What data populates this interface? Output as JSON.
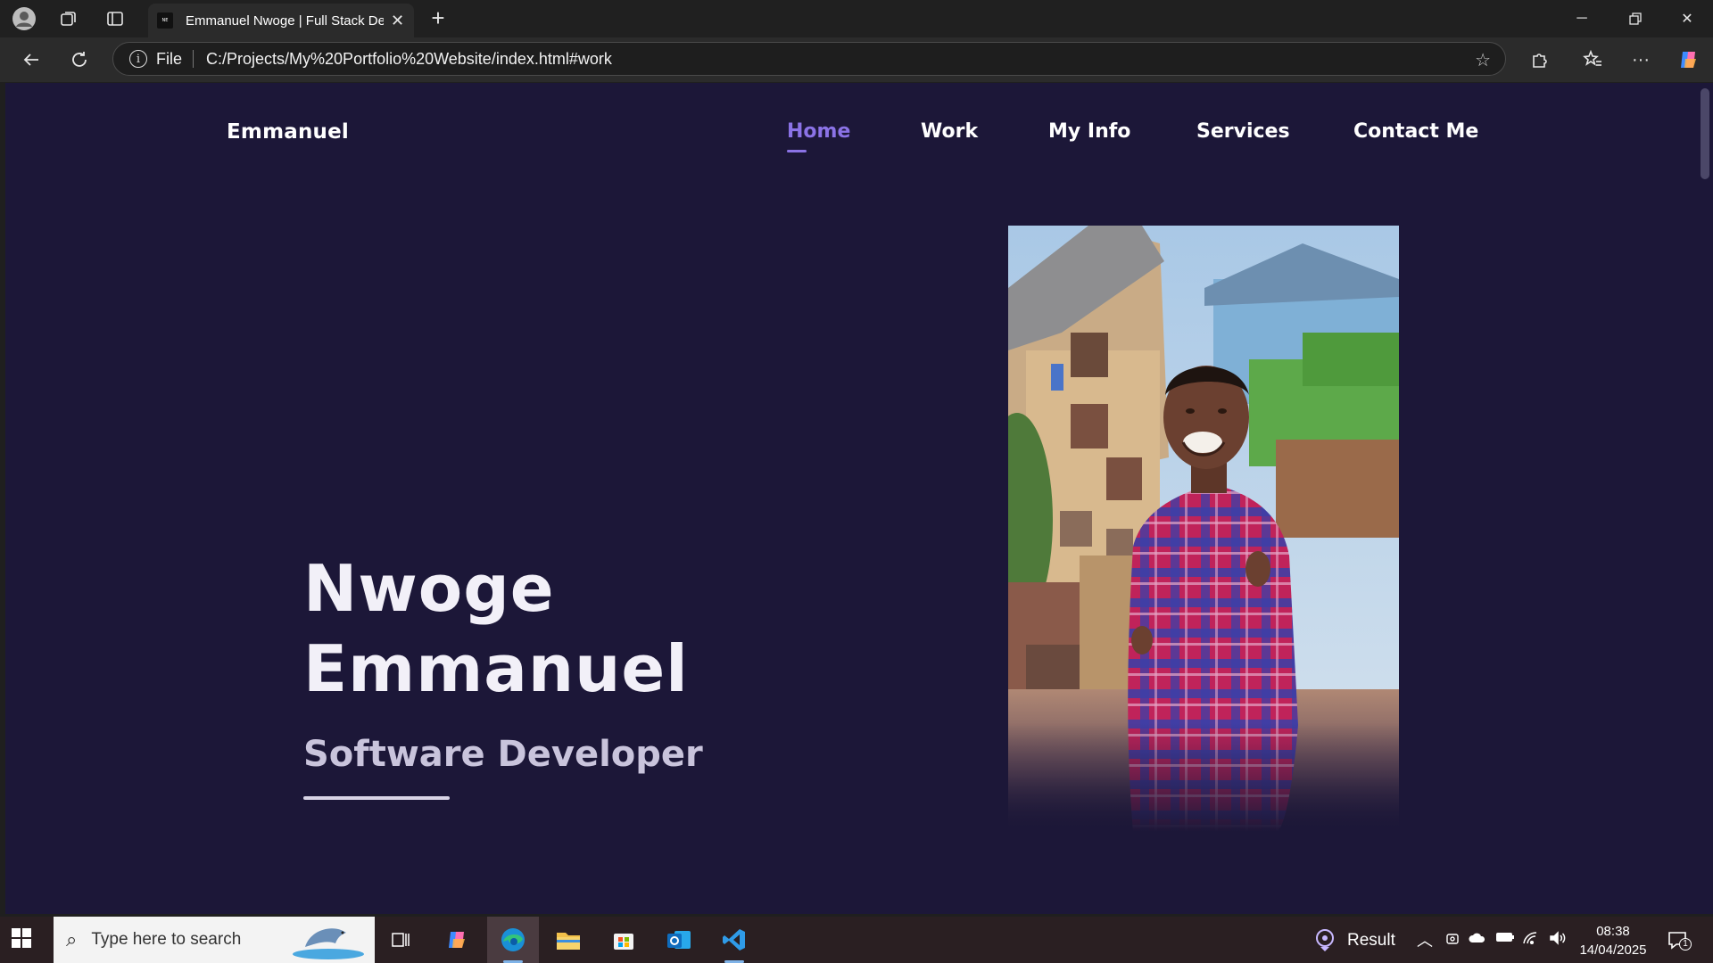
{
  "browser": {
    "tab_title": "Emmanuel Nwoge | Full Stack Developer",
    "favicon_text": "NE",
    "address_scheme": "File",
    "url": "C:/Projects/My%20Portfolio%20Website/index.html#work"
  },
  "site": {
    "brand": "Emmanuel",
    "nav": [
      "Home",
      "Work",
      "My Info",
      "Services",
      "Contact Me"
    ],
    "active_nav": "Home",
    "accent_color": "#8b73e6",
    "background_color": "#1c1738"
  },
  "hero": {
    "name_line1": "Nwoge",
    "name_line2": "Emmanuel",
    "role": "Software Developer"
  },
  "taskbar": {
    "search_placeholder": "Type here to search",
    "widget_label": "Result",
    "time": "08:38",
    "date": "14/04/2025",
    "notification_count": "1"
  }
}
